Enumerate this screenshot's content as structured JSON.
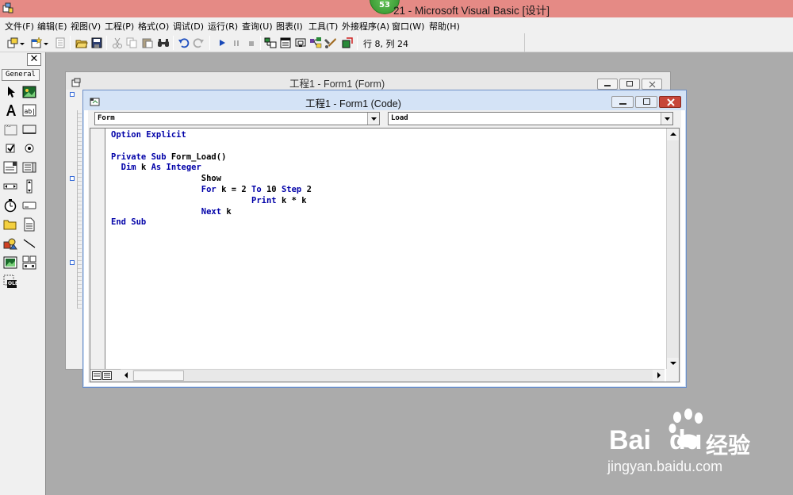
{
  "window": {
    "title": "21 - Microsoft Visual Basic [设计]",
    "badge": "53"
  },
  "menu": [
    "文件(F)",
    "编辑(E)",
    "视图(V)",
    "工程(P)",
    "格式(O)",
    "调试(D)",
    "运行(R)",
    "查询(U)",
    "图表(I)",
    "工具(T)",
    "外接程序(A)",
    "窗口(W)",
    "帮助(H)"
  ],
  "toolbar": {
    "cursor_position": "行 8, 列 24"
  },
  "toolbox": {
    "close": "✕",
    "tab": "General",
    "ole_label": "OLE"
  },
  "form_window": {
    "title": "工程1 - Form1 (Form)"
  },
  "code_window": {
    "title": "工程1 - Form1 (Code)",
    "object_combo": "Form",
    "procedure_combo": "Load",
    "lines": [
      [
        {
          "t": "Option Explicit",
          "kw": true
        }
      ],
      [],
      [
        {
          "t": "Private Sub ",
          "kw": true
        },
        {
          "t": "Form_Load()",
          "kw": false
        }
      ],
      [
        {
          "t": "  Dim ",
          "kw": true
        },
        {
          "t": "k ",
          "kw": false
        },
        {
          "t": "As Integer",
          "kw": true
        }
      ],
      [
        {
          "t": "                  Show",
          "kw": false
        }
      ],
      [
        {
          "t": "                  For ",
          "kw": true
        },
        {
          "t": "k = 2 ",
          "kw": false
        },
        {
          "t": "To ",
          "kw": true
        },
        {
          "t": "10 ",
          "kw": false
        },
        {
          "t": "Step ",
          "kw": true
        },
        {
          "t": "2",
          "kw": false
        }
      ],
      [
        {
          "t": "                            Print ",
          "kw": true
        },
        {
          "t": "k * k",
          "kw": false
        }
      ],
      [
        {
          "t": "                  Next ",
          "kw": true
        },
        {
          "t": "k",
          "kw": false
        }
      ],
      [
        {
          "t": "End Sub",
          "kw": true
        }
      ]
    ]
  },
  "watermark": {
    "brand": "Bai",
    "brand2": "du",
    "product": "经验",
    "url": "jingyan.baidu.com"
  },
  "colors": {
    "title_bar": "#e58a85",
    "keyword": "#0000a8",
    "code_title_bar": "#d4e3f6"
  }
}
